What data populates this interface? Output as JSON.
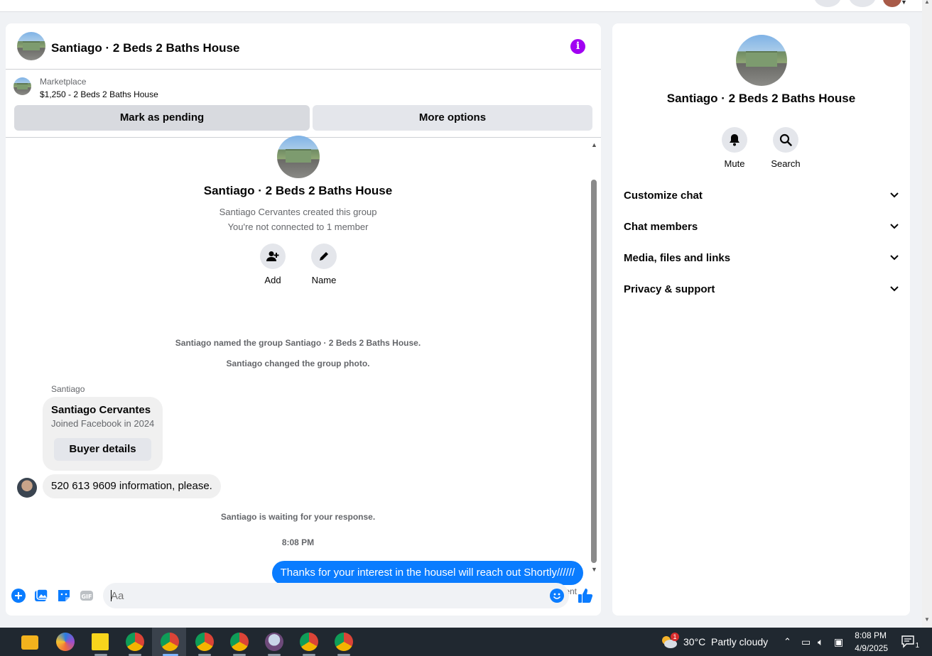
{
  "chat": {
    "title": "Santiago · 2 Beds 2 Baths House",
    "marketplace_label": "Marketplace",
    "listing": "$1,250 - 2 Beds 2 Baths House",
    "mark_pending_label": "Mark as pending",
    "more_options_label": "More options",
    "group_title": "Santiago · 2 Beds 2 Baths House",
    "created_text": "Santiago Cervantes created this group",
    "connected_text": "You're not connected to 1 member",
    "add_label": "Add",
    "name_label": "Name",
    "system_named": "Santiago named the group Santiago · 2 Beds 2 Baths House.",
    "system_photo": "Santiago changed the group photo.",
    "sender": "Santiago",
    "card_name": "Santiago Cervantes",
    "card_sub": "Joined Facebook in 2024",
    "buyer_details_label": "Buyer details",
    "incoming_message": "520 613 9609 information, please.",
    "waiting_text": "Santiago is waiting for your response.",
    "timestamp": "8:08 PM",
    "outgoing_message": "Thanks for your interest in the housel will reach out Shortly//////",
    "sent_status": "Sent",
    "composer_placeholder": "Aa"
  },
  "info": {
    "title": "Santiago · 2 Beds 2 Baths House",
    "mute_label": "Mute",
    "search_label": "Search",
    "sections": [
      "Customize chat",
      "Chat members",
      "Media, files and links",
      "Privacy & support"
    ]
  },
  "taskbar": {
    "weather_temp": "30°C",
    "weather_desc": "Partly cloudy",
    "weather_badge": "1",
    "time": "8:08 PM",
    "date": "4/9/2025",
    "notification_count": "1"
  },
  "colors": {
    "accent": "#0a7cff",
    "info_icon": "#a100f2",
    "taskbar": "#202830"
  }
}
